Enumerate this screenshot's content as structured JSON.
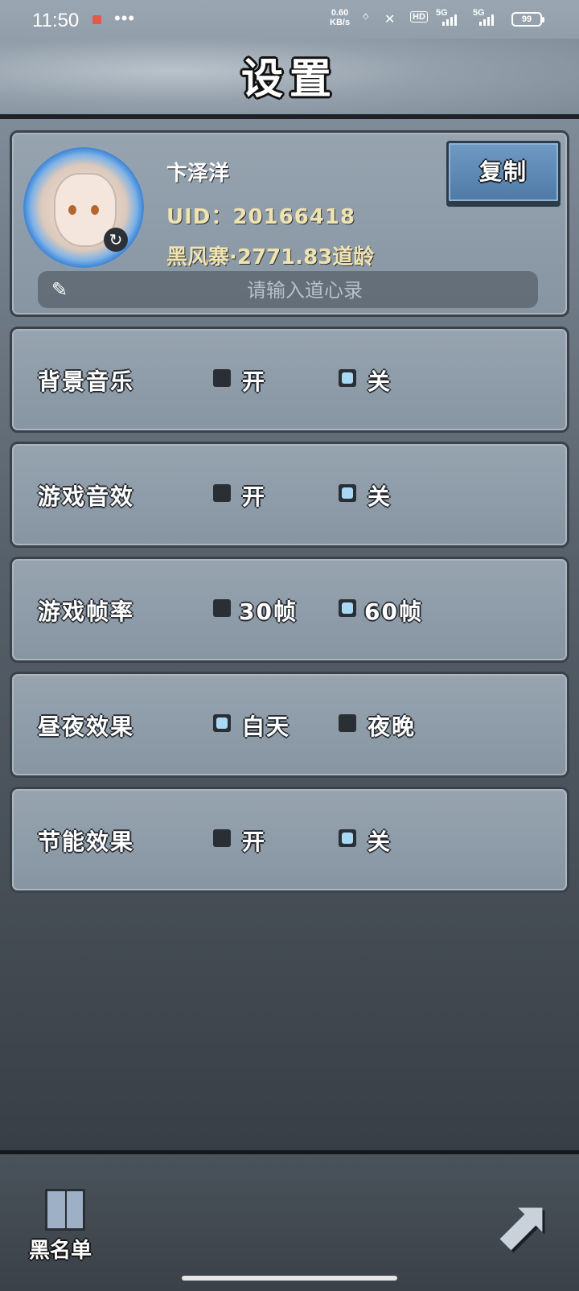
{
  "status_bar": {
    "time": "11:50",
    "more": "•••",
    "net_speed_value": "0.60",
    "net_speed_unit": "KB/s",
    "hd": "HD",
    "sim1": "5G",
    "sim2": "5G",
    "battery": "99"
  },
  "header": {
    "title": "设置"
  },
  "profile": {
    "username": "卞泽洋",
    "uid_text": "UID：20166418",
    "guild_text": "黑风寨·2771.83道龄",
    "copy_label": "复制",
    "motto_placeholder": "请输入道心录",
    "motto_value": ""
  },
  "settings": [
    {
      "label": "背景音乐",
      "options": [
        {
          "label": "开",
          "selected": false
        },
        {
          "label": "关",
          "selected": true
        }
      ]
    },
    {
      "label": "游戏音效",
      "options": [
        {
          "label": "开",
          "selected": false
        },
        {
          "label": "关",
          "selected": true
        }
      ]
    },
    {
      "label": "游戏帧率",
      "options": [
        {
          "label": "30帧",
          "selected": false
        },
        {
          "label": "60帧",
          "selected": true
        }
      ]
    },
    {
      "label": "昼夜效果",
      "options": [
        {
          "label": "白天",
          "selected": true
        },
        {
          "label": "夜晚",
          "selected": false
        }
      ]
    },
    {
      "label": "节能效果",
      "options": [
        {
          "label": "开",
          "selected": false
        },
        {
          "label": "关",
          "selected": true
        }
      ]
    }
  ],
  "footer": {
    "blacklist_label": "黑名单"
  },
  "colors": {
    "selected_box": "#a9d8f5",
    "copy_button": "#5f8ab6",
    "uid_text": "#efe3b0"
  }
}
